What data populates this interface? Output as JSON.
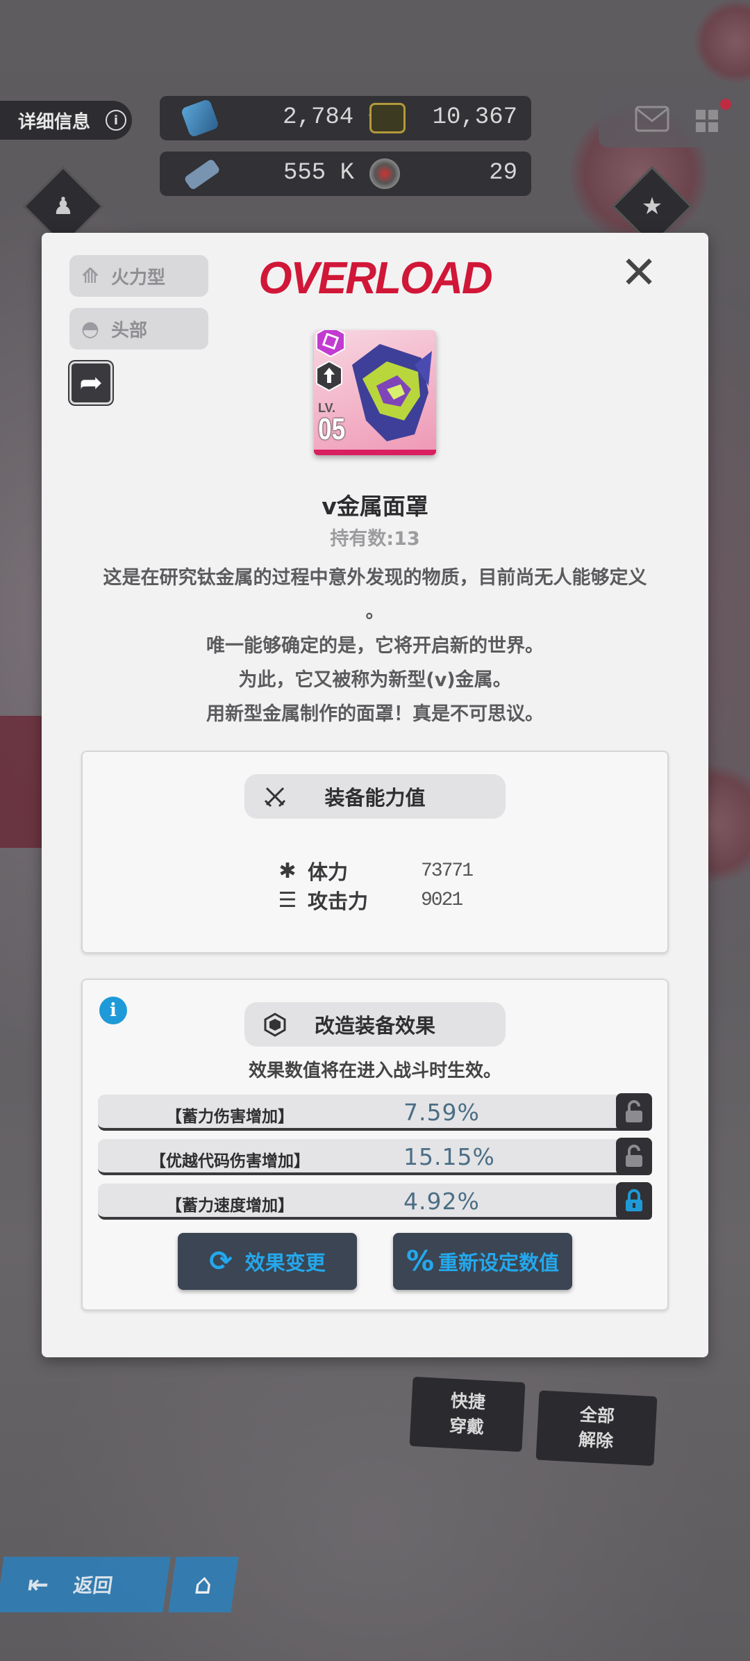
{
  "hud": {
    "detail_tab": "详细信息",
    "info_glyph": "i",
    "resources": [
      {
        "icon": "crystal-gem-icon",
        "value": "2,784 +"
      },
      {
        "icon": "credit-card-icon",
        "value": "10,367"
      },
      {
        "icon": "battery-core-icon",
        "value": "555 K"
      },
      {
        "icon": "core-dust-icon",
        "value": "29"
      }
    ]
  },
  "modal": {
    "logo": "OVERLOAD",
    "tags": {
      "class": "火力型",
      "slot": "头部"
    },
    "item": {
      "level_label": "LV.",
      "level": "05",
      "name": "v金属面罩",
      "owned": "持有数:13",
      "description": [
        "这是在研究钛金属的过程中意外发现的物质，目前尚无人能够定义",
        "。",
        "唯一能够确定的是，它将开启新的世界。",
        "为此，它又被称为新型(v)金属。",
        "用新型金属制作的面罩！真是不可思议。"
      ]
    },
    "stats_panel": {
      "title": "装备能力值",
      "stats": [
        {
          "label": "体力",
          "value": "73771",
          "icon": "asterisk-icon"
        },
        {
          "label": "攻击力",
          "value": "9021",
          "icon": "bullets-icon"
        }
      ]
    },
    "effects_panel": {
      "title": "改造装备效果",
      "notice": "效果数值将在进入战斗时生效。",
      "effects": [
        {
          "label": "【蓄力伤害增加】",
          "value": "7.59%",
          "locked": false
        },
        {
          "label": "【优越代码伤害增加】",
          "value": "15.15%",
          "locked": false
        },
        {
          "label": "【蓄力速度增加】",
          "value": "4.92%",
          "locked": true
        }
      ],
      "buttons": {
        "change": "效果变更",
        "reset": "重新设定数值"
      }
    }
  },
  "bottom": {
    "quick_equip": "快捷 穿戴",
    "unequip_all": "全部 解除",
    "back": "返回"
  },
  "colors": {
    "accent": "#1e9ad8",
    "logo": "#d01738",
    "rarity": "#d91f5f"
  }
}
